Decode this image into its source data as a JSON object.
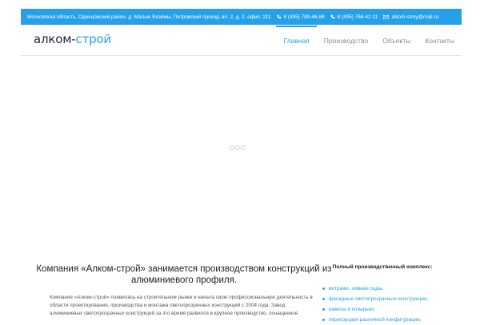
{
  "topbar": {
    "address": "Московская область, Одинцовский район, д. Малые Вязёмы, Петровский проезд, вл. 2, д. 2, офис. 211",
    "phone1": "8 (495) 789-46-88",
    "phone2": "8 (495) 766-42-11",
    "email": "alkom-stroy@mail.ru",
    "accent_color": "#27a0ea"
  },
  "header": {
    "logo_part1": "алком-",
    "logo_part2": "строй",
    "menu": [
      {
        "label": "Главная",
        "active": true
      },
      {
        "label": "Производство",
        "active": false
      },
      {
        "label": "Объекты",
        "active": false
      },
      {
        "label": "Контакты",
        "active": false
      }
    ]
  },
  "main": {
    "headline": "Компания «Алком-строй» занимается производством конструкций из алюминиевого профиля.",
    "paragraph": "Компания «Алком-строй» появилась на строительном рынке и начала свою профессиональную деятельность в области проектирования, производства и монтажа светопрозрачных конструкций с 2004 года. Завод алюминиевых светопрозрачных конструкций за это время развился в крупное производство, оснащенное"
  },
  "sidebar": {
    "title": "Полный производственный комплекс:",
    "items": [
      "витражи, зимние сады,",
      "фасадные светопрозрачные конструкции,",
      "навесы и козырьки,",
      "перегородки различной конфигурации,"
    ]
  }
}
